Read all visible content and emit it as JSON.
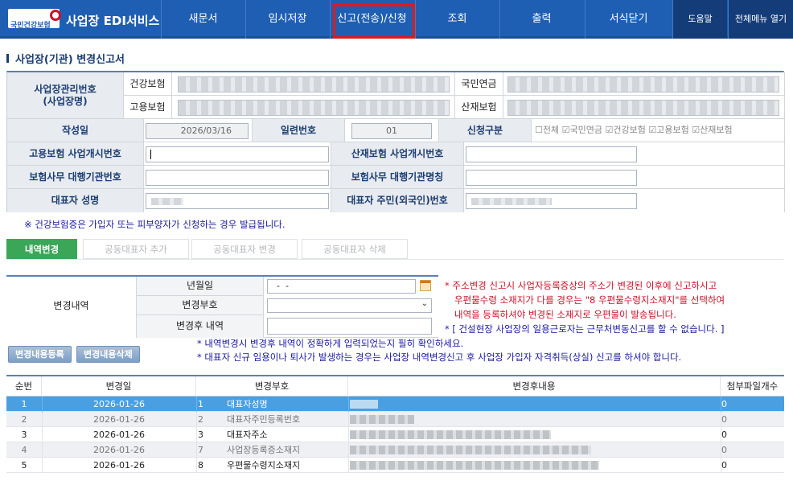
{
  "header": {
    "logo_text": "국민건강보험",
    "service_title": "사업장 EDI서비스",
    "nav": [
      "새문서",
      "임시저장",
      "신고(전송)/신청",
      "조회",
      "출력",
      "서식닫기"
    ],
    "help": "도움말",
    "menu_open": "전체메뉴 열기"
  },
  "page_title": "사업장(기관) 변경신고서",
  "form": {
    "mgmt_no_label": "사업장관리번호\n(사업장명)",
    "health_ins": "건강보험",
    "employ_ins": "고용보험",
    "national_pension": "국민연금",
    "industrial_ins": "산재보험",
    "created_label": "작성일",
    "created_value": "2026/03/16",
    "serial_label": "일련번호",
    "serial_value": "01",
    "apply_type_label": "신청구분",
    "apply_options": [
      "전체",
      "국민연금",
      "건강보험",
      "고용보험",
      "산재보험"
    ],
    "emp_start_label": "고용보험 사업개시번호",
    "ind_start_label": "산재보험 사업개시번호",
    "agent_no_label": "보험사무 대행기관번호",
    "agent_name_label": "보험사무 대행기관명칭",
    "rep_name_label": "대표자 성명",
    "rep_id_label": "대표자 주민(외국인)번호"
  },
  "notice": "※ 건강보험증은 가입자 또는 피부양자가 신청하는 경우 발급됩니다.",
  "tabs": [
    "내역변경",
    "공동대표자 추가",
    "공동대표자 변경",
    "공동대표자 삭제"
  ],
  "change": {
    "section_label": "변경내역",
    "date_label": "년월일",
    "date_value": "  -  -",
    "code_label": "변경부호",
    "after_label": "변경후 내역"
  },
  "red_notes": [
    "* 주소변경 신고시 사업자등록증상의 주소가 변경된 이후에 신고하시고",
    "우편물수령 소재지가 다를 경우는 \"8 우편물수령지소재지\"를 선택하여",
    "내역을 등록하셔야 변경된 소재지로 우편물이 발송됩니다.",
    "* [ 건설현장 사업장의 일용근로자는 근무처변동신고를 할 수 없습니다. ]"
  ],
  "blue_notes": [
    "* 내역변경시 변경후 내역이 정확하게 입력되었는지 필히 확인하세요.",
    "* 대표자 신규 임용이나 퇴사가 발생하는 경우는 사업장 내역변경신고 후 사업장 가입자 자격취득(상실) 신고를 하셔야 합니다."
  ],
  "buttons": {
    "register": "변경내용등록",
    "delete": "변경내용삭제"
  },
  "list": {
    "headers": [
      "순번",
      "변경일",
      "변경부호",
      "변경후내용",
      "첨부파일개수"
    ],
    "rows": [
      {
        "seq": "1",
        "date": "2026-01-26",
        "code": "1",
        "code_name": "대표자성명",
        "files": "0"
      },
      {
        "seq": "2",
        "date": "2026-01-26",
        "code": "2",
        "code_name": "대표자주민등록번호",
        "files": "0"
      },
      {
        "seq": "3",
        "date": "2026-01-26",
        "code": "3",
        "code_name": "대표자주소",
        "files": "0"
      },
      {
        "seq": "4",
        "date": "2026-01-26",
        "code": "7",
        "code_name": "사업장등록증소재지",
        "files": "0"
      },
      {
        "seq": "5",
        "date": "2026-01-26",
        "code": "8",
        "code_name": "우편물수령지소재지",
        "files": "0"
      }
    ]
  },
  "colors": {
    "nav_bg": "#1e5fb3",
    "selected_row": "#4a9fe0",
    "highlight": "#e01a1a",
    "tab_active": "#3aa657",
    "red_note": "#d0102a",
    "blue_note": "#1a1aa0"
  }
}
